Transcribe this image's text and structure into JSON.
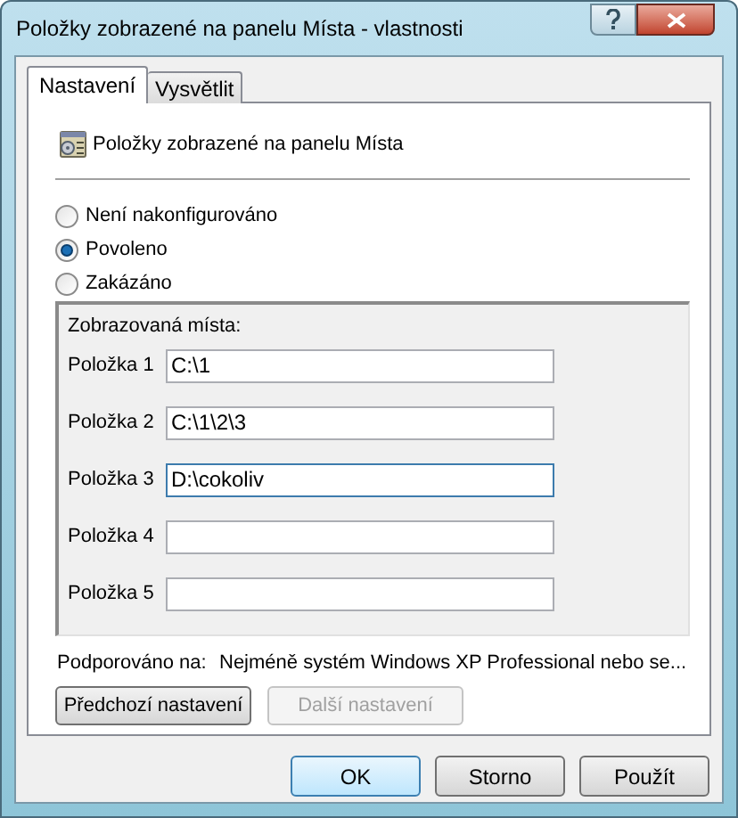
{
  "window": {
    "title": "Položky zobrazené na panelu Místa - vlastnosti"
  },
  "tabs": [
    {
      "label": "Nastavení",
      "selected": true
    },
    {
      "label": "Vysvětlit",
      "selected": false
    }
  ],
  "policy": {
    "name": "Položky zobrazené na panelu Místa"
  },
  "options": [
    {
      "label": "Není nakonfigurováno",
      "selected": false
    },
    {
      "label": "Povoleno",
      "selected": true
    },
    {
      "label": "Zakázáno",
      "selected": false
    }
  ],
  "places": {
    "caption": "Zobrazovaná místa:",
    "items": [
      {
        "label": "Položka 1",
        "value": "C:\\1",
        "focused": false
      },
      {
        "label": "Položka 2",
        "value": "C:\\1\\2\\3",
        "focused": false
      },
      {
        "label": "Položka 3",
        "value": "D:\\cokoliv",
        "focused": true
      },
      {
        "label": "Položka 4",
        "focused": false
      },
      {
        "label": "Položka 5",
        "focused": false
      }
    ]
  },
  "supported": {
    "label": "Podporováno na:",
    "value": "Nejméně systém Windows XP Professional nebo se..."
  },
  "nav_buttons": [
    {
      "label": "Předchozí nastavení",
      "disabled": false
    },
    {
      "label": "Další nastavení",
      "disabled": true
    }
  ],
  "buttons": [
    {
      "label": "OK",
      "default": true
    },
    {
      "label": "Storno",
      "default": false
    },
    {
      "label": "Použít",
      "default": false
    }
  ]
}
